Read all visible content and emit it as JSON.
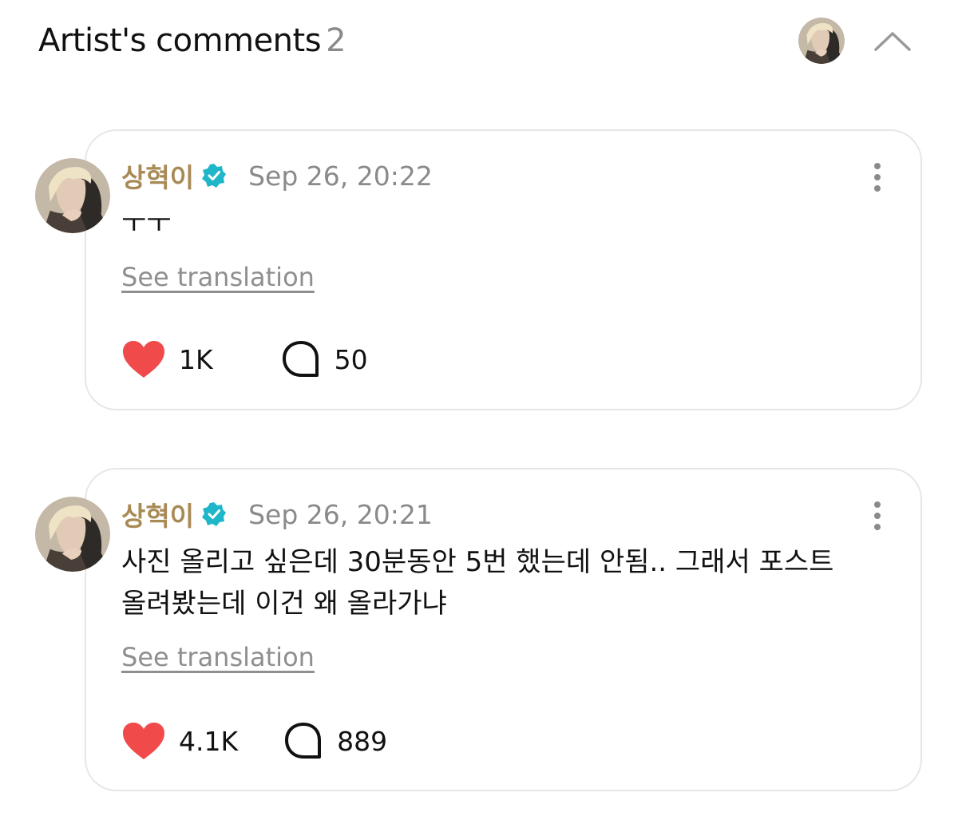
{
  "header": {
    "title": "Artist's comments",
    "count": "2",
    "icons": {
      "avatar": "artist-avatar",
      "collapse": "chevron-up-icon"
    }
  },
  "colors": {
    "author": "#a88a55",
    "verified": "#1fb6c9",
    "heart": "#f04a4a",
    "muted": "#8a8a8a",
    "border": "#e6e6e6"
  },
  "comments": [
    {
      "author": "상혁이",
      "verified": true,
      "timestamp": "Sep 26, 20:22",
      "text": "ㅜㅜ",
      "translate_label": "See translation",
      "likes": "1K",
      "replies": "50"
    },
    {
      "author": "상혁이",
      "verified": true,
      "timestamp": "Sep 26, 20:21",
      "text": "사진 올리고 싶은데 30분동안 5번 했는데 안됨.. 그래서 포스트 올려봤는데 이건 왜 올라가냐",
      "translate_label": "See translation",
      "likes": "4.1K",
      "replies": "889"
    }
  ]
}
